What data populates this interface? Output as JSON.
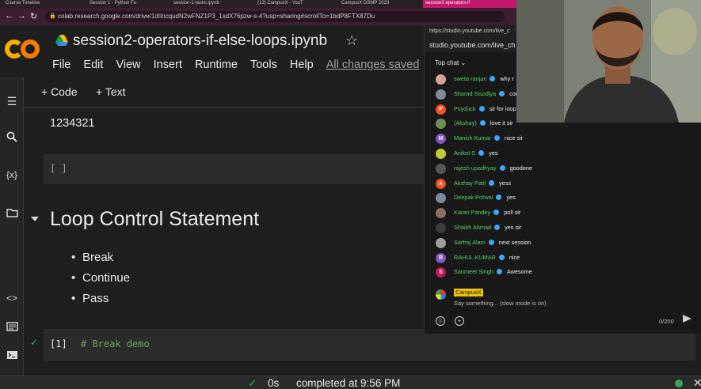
{
  "browser": {
    "tabs": [
      {
        "label": "Course Timeline",
        "active": false
      },
      {
        "label": "Session 1 - Python Fu",
        "active": false
      },
      {
        "label": "session-1-tasks.ipynb",
        "active": false
      },
      {
        "label": "(12) CampusX - YouT",
        "active": false
      },
      {
        "label": "CampusX DSMP 2023",
        "active": false
      },
      {
        "label": "session2-operators-if",
        "active": true
      }
    ],
    "url": "colab.research.google.com/drive/1dIIncqudN2wFNZ1P3_1sdX76pzw-s-4?usp=sharing#scrollTo=1bdP8FTX87Du"
  },
  "colab": {
    "logo_text": "CO",
    "notebook_title": "session2-operators-if-else-loops.ipynb",
    "menu": [
      "File",
      "Edit",
      "View",
      "Insert",
      "Runtime",
      "Tools",
      "Help"
    ],
    "save_status": "All changes saved",
    "toolbar": {
      "code_label": "+ Code",
      "text_label": "+ Text"
    },
    "rail_icons": [
      "menu-icon",
      "search-icon",
      "variables-icon",
      "folder-icon",
      "code-snippets-icon",
      "terminal-list-icon",
      "terminal-icon"
    ],
    "rail_variables_symbol": "{x}",
    "output_value": "1234321",
    "empty_cell_prompt": "[ ]",
    "section_heading": "Loop Control Statement",
    "bullets": [
      "Break",
      "Continue",
      "Pass"
    ],
    "code_cell": {
      "prompt": "[1]",
      "code": "# Break demo"
    },
    "status": {
      "duration": "0s",
      "completed": "completed at 9:56 PM"
    }
  },
  "youtube": {
    "url_line1": "https://studio.youtube.com/live_c",
    "url_line2": "studio.youtube.com/live_ch",
    "chat_mode": "Top chat",
    "messages": [
      {
        "user": "sweta ranjan",
        "text": "why r",
        "avatar": "",
        "color": "#d8a48f"
      },
      {
        "user": "Sharad Sisodiya",
        "text": "cor",
        "avatar": "",
        "color": "#7f8c9a"
      },
      {
        "user": "Psyduck",
        "text": "sir for loop",
        "avatar": "P",
        "color": "#f4511e"
      },
      {
        "user": "(Akshay)",
        "text": "love it sir",
        "avatar": "",
        "color": "#6d8f5a"
      },
      {
        "user": "Manish Kumar",
        "text": "nice sir",
        "avatar": "M",
        "color": "#7e57c2"
      },
      {
        "user": "Aniket S",
        "text": "yes",
        "avatar": "",
        "color": "#c0ca33"
      },
      {
        "user": "rajesh upadhyay",
        "text": "goodone",
        "avatar": "",
        "color": "#555555"
      },
      {
        "user": "Akshay Patil",
        "text": "yess",
        "avatar": "A",
        "color": "#f4511e"
      },
      {
        "user": "Deepak Porwal",
        "text": "yes",
        "avatar": "",
        "color": "#7a8a99"
      },
      {
        "user": "Karan Pandey",
        "text": "poll sir",
        "avatar": "",
        "color": "#8d6e63"
      },
      {
        "user": "Shaikh Ahmad",
        "text": "yes sir",
        "avatar": "",
        "color": "#3b3b3b"
      },
      {
        "user": "Sarfraj Alam",
        "text": "next session",
        "avatar": "",
        "color": "#9e9e9e"
      },
      {
        "user": "RAHUL KUMAR",
        "text": "nice",
        "avatar": "R",
        "color": "#7e57c2"
      },
      {
        "user": "Sanmeet Singh",
        "text": "Awesome",
        "avatar": "S",
        "color": "#c2185b"
      }
    ],
    "channel_name": "CampusX",
    "input_placeholder": "Say something... (slow mode is on)",
    "char_counter": "0/200"
  }
}
